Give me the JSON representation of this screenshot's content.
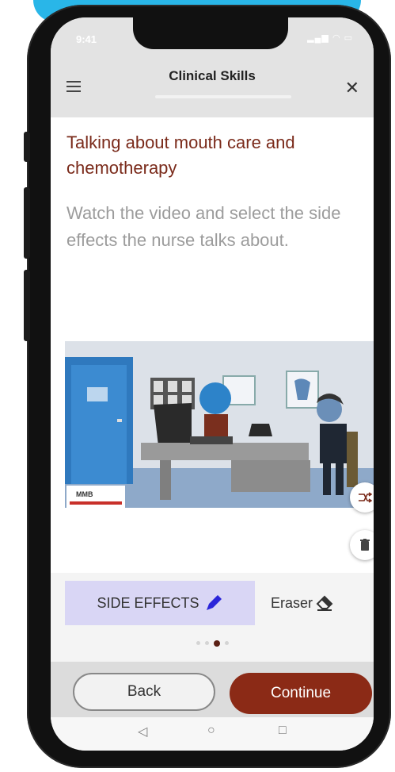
{
  "status_bar": {
    "time": "9:41",
    "icons": "signal-wifi-battery"
  },
  "app_bar": {
    "title": "Clinical Skills"
  },
  "lesson": {
    "heading": "Talking about mouth care and chemotherapy",
    "instruction": "Watch the video and select the side effects the nurse talks about."
  },
  "video": {
    "sign_text": "MMB"
  },
  "toolbar": {
    "side_effects_label": "SIDE EFFECTS",
    "eraser_label": "Eraser"
  },
  "pagination": {
    "total": 4,
    "current": 3
  },
  "buttons": {
    "back": "Back",
    "continue": "Continue"
  },
  "colors": {
    "accent": "#29b6e8",
    "brand": "#8b2a16",
    "heading": "#7a2a1a",
    "highlight": "#d9d6f5"
  }
}
